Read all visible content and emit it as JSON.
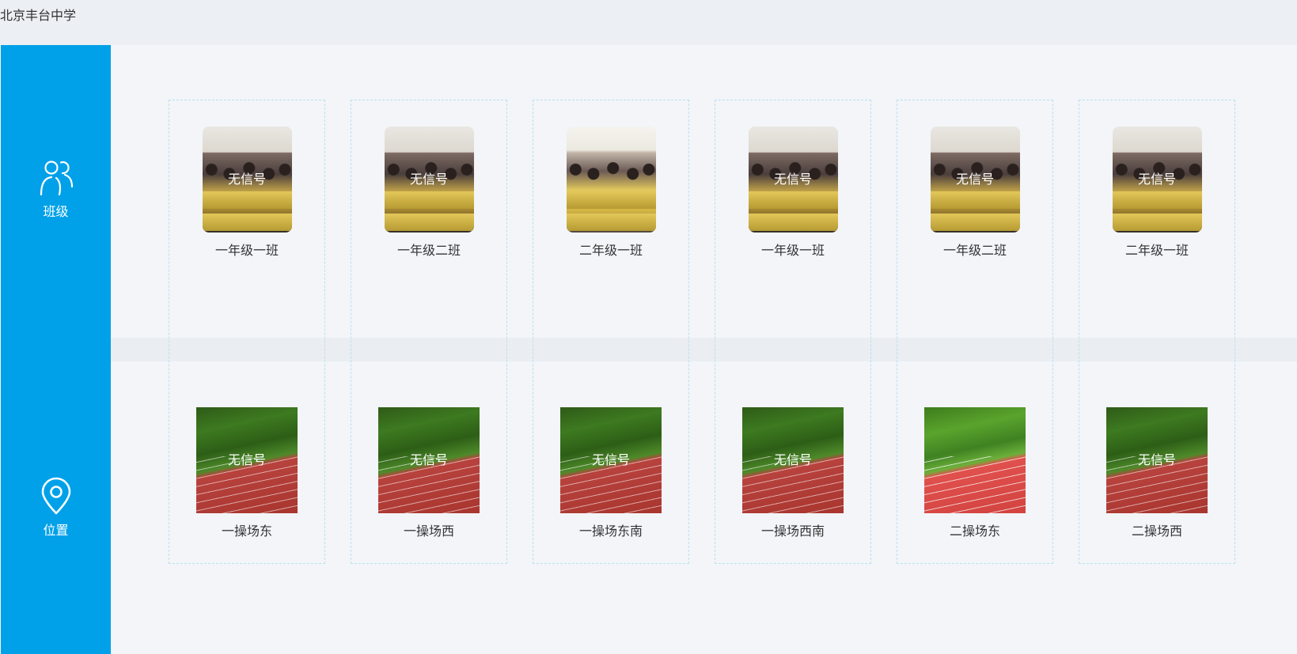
{
  "header": {
    "school_name": "北京丰台中学"
  },
  "sidebar": {
    "items": [
      {
        "label": "班级",
        "icon": "users-icon"
      },
      {
        "label": "位置",
        "icon": "location-pin-icon"
      }
    ],
    "background": "#00a1e9"
  },
  "status_overlay": "无信号",
  "classrooms": [
    {
      "name": "一年级一班",
      "status": "无信号"
    },
    {
      "name": "一年级二班",
      "status": "无信号"
    },
    {
      "name": "二年级一班",
      "status": ""
    },
    {
      "name": "一年级一班",
      "status": "无信号"
    },
    {
      "name": "一年级二班",
      "status": "无信号"
    },
    {
      "name": "二年级一班",
      "status": "无信号"
    }
  ],
  "locations": [
    {
      "name": "一操场东",
      "status": "无信号"
    },
    {
      "name": "一操场西",
      "status": "无信号"
    },
    {
      "name": "一操场东南",
      "status": "无信号"
    },
    {
      "name": "一操场西南",
      "status": "无信号"
    },
    {
      "name": "二操场东",
      "status": ""
    },
    {
      "name": "二操场西",
      "status": "无信号"
    }
  ]
}
